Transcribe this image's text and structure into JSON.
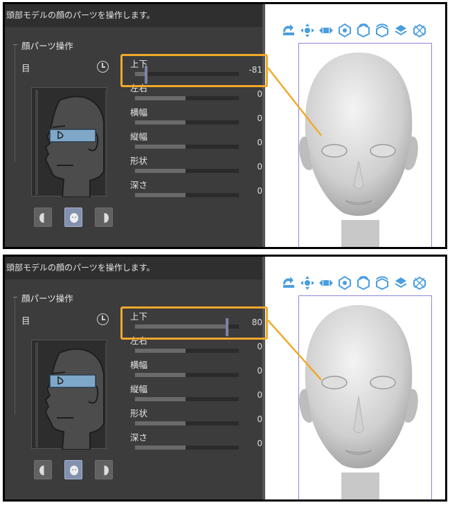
{
  "screens": [
    {
      "header_text": "頭部モデルの顔のパーツを操作します。",
      "section_title": "顔パーツ操作",
      "part_label": "目",
      "sliders": [
        {
          "label": "上下",
          "value": "-81",
          "level": -81
        },
        {
          "label": "左右",
          "value": "0",
          "level": 0
        },
        {
          "label": "横幅",
          "value": "0",
          "level": 0
        },
        {
          "label": "縦幅",
          "value": "0",
          "level": 0
        },
        {
          "label": "形状",
          "value": "0",
          "level": 0
        },
        {
          "label": "深さ",
          "value": "0",
          "level": 0
        }
      ],
      "eye_position": "low"
    },
    {
      "header_text": "頭部モデルの顔のパーツを操作します。",
      "section_title": "顔パーツ操作",
      "part_label": "目",
      "sliders": [
        {
          "label": "上下",
          "value": "80",
          "level": 80
        },
        {
          "label": "左右",
          "value": "0",
          "level": 0
        },
        {
          "label": "横幅",
          "value": "0",
          "level": 0
        },
        {
          "label": "縦幅",
          "value": "0",
          "level": 0
        },
        {
          "label": "形状",
          "value": "0",
          "level": 0
        },
        {
          "label": "深さ",
          "value": "0",
          "level": 0
        }
      ],
      "eye_position": "high"
    }
  ],
  "view_buttons": [
    "left-half-face-icon",
    "full-face-icon",
    "right-half-face-icon"
  ],
  "toolbar_icons": [
    "rotate-camera-icon",
    "pan-camera-icon",
    "dolly-camera-icon",
    "move-object-icon",
    "rotate-object-icon",
    "rotate-xy-icon",
    "rotate-plane-icon",
    "reset-view-icon"
  ],
  "colors": {
    "panel_bg": "#3c3c3c",
    "highlight": "#f2a92a",
    "toolbar_icon": "#4a9ede",
    "active_button": "#8391b0",
    "eye_band": "#7fa8c8"
  }
}
